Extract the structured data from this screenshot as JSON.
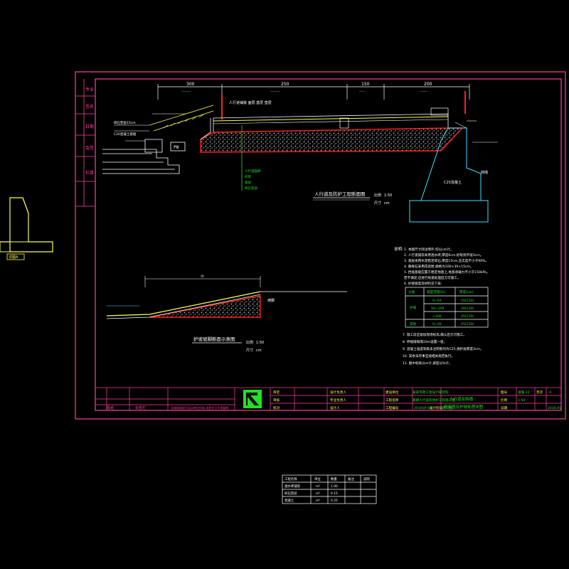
{
  "colors": {
    "background": "#000000",
    "frame": "#ff3fa0",
    "line": "#ffffff",
    "accent_yellow": "#ffff55",
    "accent_green": "#22e022",
    "accent_red": "#ff2020",
    "accent_cyan": "#40e0ff"
  },
  "section_main": {
    "title": "人行道及防护工程断面图",
    "scale_label_1": "比例",
    "scale_value_1": "1:50",
    "scale_label_2": "尺寸",
    "scale_value_2": "cm"
  },
  "section_slope": {
    "title": "护坡坡脚断面示意图",
    "scale_label_1": "比例",
    "scale_value_1": "1:50",
    "scale_label_2": "尺寸",
    "scale_value_2": "cm",
    "edge_label": "坡脚"
  },
  "dimensions": [
    "300",
    "250",
    "150",
    "200"
  ],
  "callouts": {
    "top_note": "人行道铺装  面层  基层  垫层",
    "left_note_1": "碎石垫层15cm",
    "left_note_2": "C20混凝土基础",
    "base_tag": "P8",
    "wall_note": "挡墙",
    "wall_body": "C25混凝土",
    "mid_green_1": "人行道面砖",
    "mid_green_2": "砂浆",
    "mid_green_3": "基层",
    "mid_green_4": "碎石垫层"
  },
  "notes": {
    "heading": "说明:",
    "lines": [
      "1. 本图尺寸除注明外,均以cm计。",
      "2. 人行道铺装采用透水砖,厚度6cm,砂浆找平层3cm。",
      "3. 基层采用水泥稳定碎石,厚度15cm,压实度不小于96%。",
      "4. 路缘石采用花岗岩,规格为100×30×15cm。",
      "5. 挡墙基础应置于稳定地基上,地基承载力不小于150kPa。",
      "   若不满足,应进行地基处理后方可施工。",
      "6. 护坡坡度及材料见下表:"
    ],
    "lines_after": [
      "7. 施工前应复核现场标高,确认后方可施工。",
      "8. 伸缩缝每隔10m设置一道。",
      "9. 混凝土强度等级未注明者均为C25,保护层厚度3cm。",
      "10. 其余未尽事宜按相关规范执行。",
      "11. 图中标高以m计,坡度以%计。"
    ]
  },
  "spec_table": {
    "headers": [
      "分类",
      "坡度范围(%)",
      "厚度(cm)"
    ],
    "group_label": "护坡",
    "rows": [
      [
        "",
        "0~50",
        "15(C20)"
      ],
      [
        "",
        "50~100",
        "20(C20)"
      ],
      [
        "",
        ">100",
        "25(C25)"
      ],
      [
        "其他",
        "0~30",
        "15(C20)"
      ]
    ]
  },
  "title_block": {
    "left_cells": [
      "审定",
      "审核",
      "校对"
    ],
    "name_cells": [
      "设计负责人",
      "专业负责人",
      "设计人"
    ],
    "company_label": "建设单位",
    "company_name": "某某市政工程设计研究院",
    "project_label": "工程名称",
    "project_name": "道路人行道及防护工程施工图",
    "proj_no_label": "工程编号",
    "proj_no": "2016SP-04",
    "stage_label": "设计阶段",
    "stage": "施工图",
    "drawing_title_1": "人行道及挡墙",
    "drawing_title_2": "断面图及护坡处理详图",
    "right_cells": [
      "图号",
      "比例",
      "日期"
    ],
    "right_values": [
      "道施-12",
      "1:50",
      "2016.05"
    ],
    "sheet_label": "页次",
    "sheet_value": "A",
    "bottom_left_label_1": "图纸",
    "bottom_left_label_2": "会签栏",
    "bottom_strip": "本图纸版权归设计单位所有,未经许可不得复制"
  },
  "side_strip": [
    "专业",
    "签名",
    "日期",
    "会签",
    "栏目"
  ],
  "left_detail": {
    "label": "详图A"
  },
  "qty_table": {
    "headers": [
      "工程名称",
      "单位",
      "数量",
      "备注",
      "说明"
    ],
    "rows": [
      [
        "透水砖铺装",
        "m²",
        "1.00",
        "",
        ""
      ],
      [
        "碎石垫层",
        "m³",
        "0.15",
        "",
        ""
      ],
      [
        "混凝土",
        "m³",
        "0.25",
        "",
        ""
      ]
    ]
  }
}
